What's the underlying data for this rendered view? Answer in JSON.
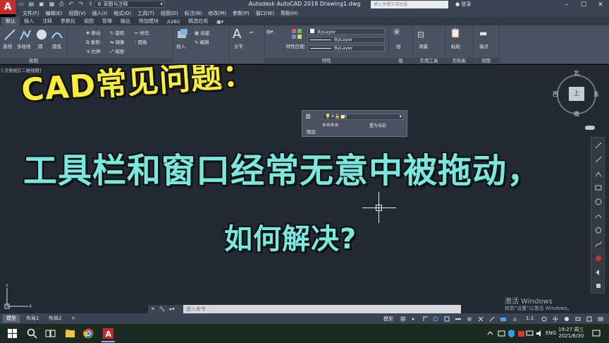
{
  "titlebar": {
    "logo": "A",
    "workspace": "草图与注释",
    "title": "Autodesk AutoCAD 2018    Drawing1.dwg",
    "search_placeholder": "键入关键字或短语",
    "login": "登录",
    "min": "–",
    "max": "☐",
    "close": "✕"
  },
  "menu": [
    "文件(F)",
    "编辑(E)",
    "视图(V)",
    "插入(I)",
    "格式(O)",
    "工具(T)",
    "绘图(D)",
    "标注(N)",
    "修改(M)",
    "参数(P)",
    "窗口(W)",
    "帮助(H)"
  ],
  "ribbon_tabs": [
    "默认",
    "插入",
    "注释",
    "参数化",
    "视图",
    "管理",
    "输出",
    "附加模块",
    "A360",
    "精选应用"
  ],
  "ribbon": {
    "draw": {
      "line": "直线",
      "polyline": "多段线",
      "circle": "圆",
      "arc": "圆弧",
      "label": "绘图"
    },
    "modify": {
      "move": "移动",
      "rotate": "旋转",
      "trim": "修剪",
      "copy": "复制",
      "mirror": "镜像",
      "fillet": "圆角",
      "stretch": "拉伸",
      "scale": "缩放"
    },
    "block": {
      "insert": "插入",
      "create": "创建",
      "edit": "编辑"
    },
    "annotation": {
      "text": "文字"
    },
    "properties": {
      "match": "特性匹配",
      "bylayer1": "ByLayer",
      "bylayer2": "ByLayer",
      "bylayer3": "ByLayer",
      "label": "特性"
    },
    "groups": {
      "group": "组",
      "label": "组"
    },
    "utilities": {
      "measure": "测量",
      "label": "实用工具"
    },
    "clipboard": {
      "paste": "粘贴",
      "label": "剪贴板"
    },
    "view": {
      "base": "基点",
      "label": "视图"
    }
  },
  "drawing": {
    "viewport_label": "[-][俯视][二维线框]",
    "caption_line1": "CAD常见问题：",
    "caption_line2": "工具栏和窗口经常无意中被拖动，",
    "caption_line3": "如何解决?",
    "float_toolbar": {
      "layer_value": "0",
      "label": "图层",
      "extra": "置为当前"
    },
    "viewcube": {
      "north": "北",
      "south": "南",
      "east": "东",
      "west": "西",
      "top": "上"
    },
    "watermark_1": "激活 Windows",
    "watermark_2": "转到\"设置\"以激活 Windows。"
  },
  "command": {
    "placeholder": "键入命令"
  },
  "layout_tabs": [
    "模型",
    "布局1",
    "布局2",
    "+"
  ],
  "status": {
    "model": "模型",
    "scale": "1:1"
  },
  "taskbar": {
    "lang": "ENG",
    "time": "19:27 周三",
    "date": "2021/6/30"
  },
  "colors": {
    "canvas": "#222933",
    "ribbon": "#4a5261",
    "caption_yellow": "#f6ee3a",
    "caption_cyan": "#7be8e0",
    "accent_red": "#c62c2c"
  }
}
